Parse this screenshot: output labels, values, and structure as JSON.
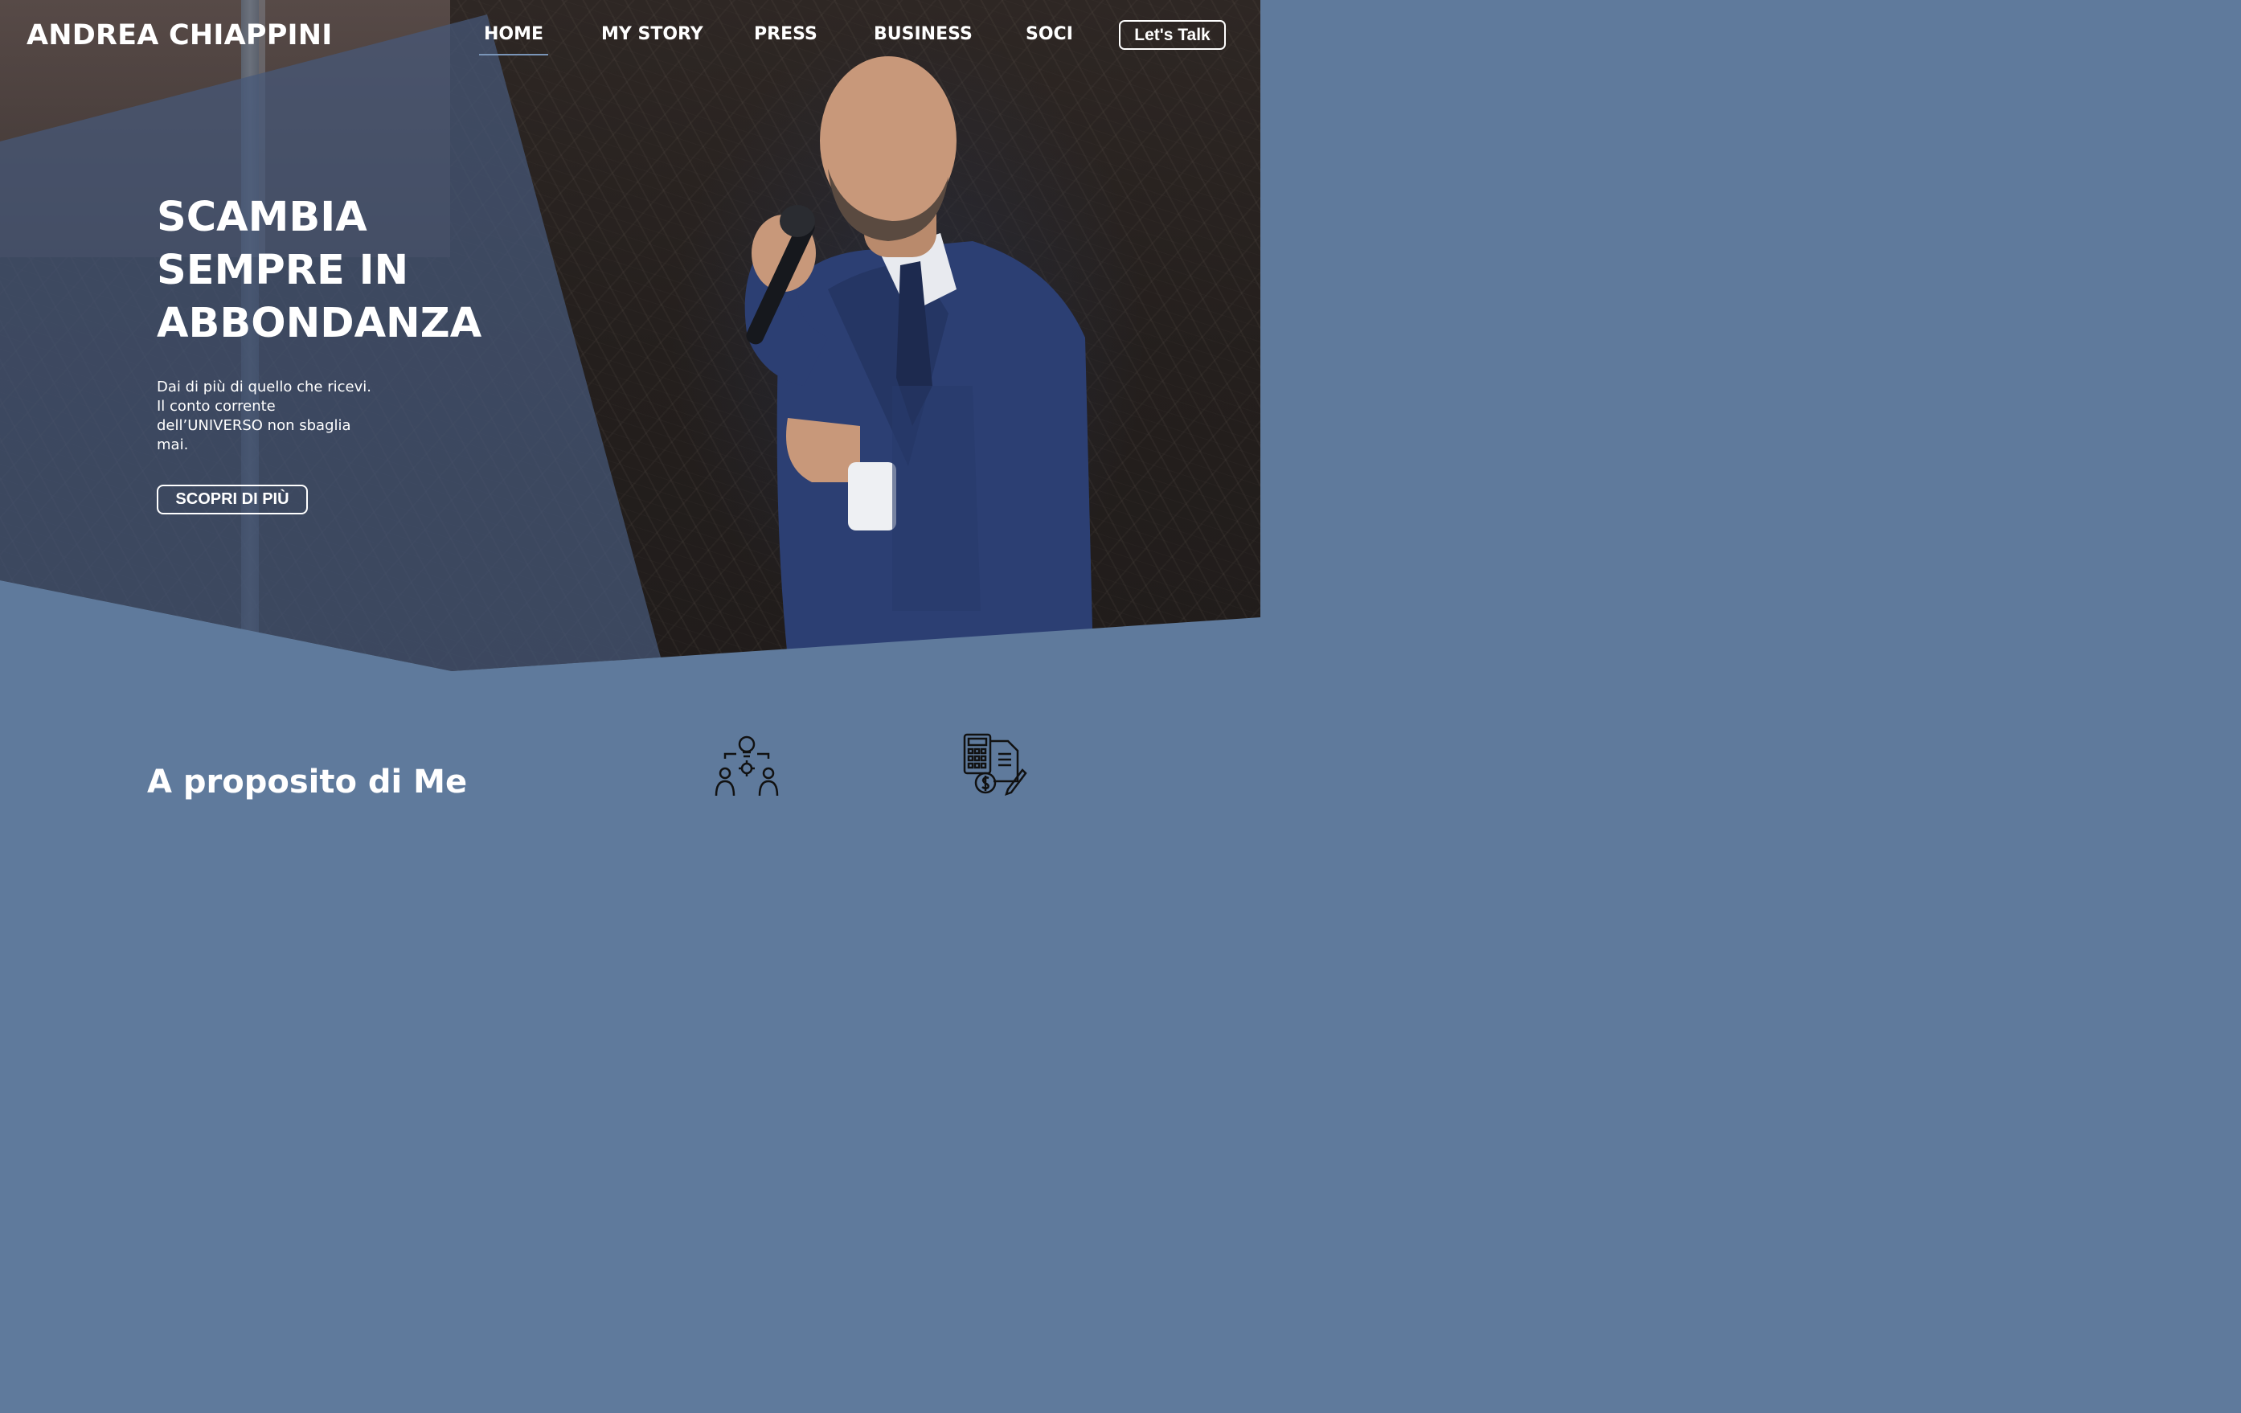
{
  "brand": {
    "name": "ANDREA CHIAPPINI"
  },
  "nav": {
    "items": [
      {
        "label": "HOME",
        "active": true
      },
      {
        "label": "MY STORY",
        "active": false
      },
      {
        "label": "PRESS",
        "active": false
      },
      {
        "label": "BUSINESS",
        "active": false
      },
      {
        "label": "SOCI",
        "active": false
      }
    ],
    "cta_label": "Let's Talk"
  },
  "hero": {
    "headline_lines": [
      "SCAMBIA",
      "SEMPRE IN",
      "ABBONDANZA"
    ],
    "subtext_lines": [
      "Dai di più di quello che ricevi.",
      "Il conto corrente",
      "dell’UNIVERSO non sbaglia",
      "mai."
    ],
    "button_label": "SCOPRI DI PIÙ"
  },
  "about": {
    "title": "A proposito di Me",
    "icons": [
      "teamwork-idea-icon",
      "calculator-finance-icon"
    ]
  },
  "colors": {
    "section_blue": "#5f7a9c",
    "panel_blue": "#46597a",
    "text": "#ffffff",
    "nav_underline": "#7a95b8"
  }
}
